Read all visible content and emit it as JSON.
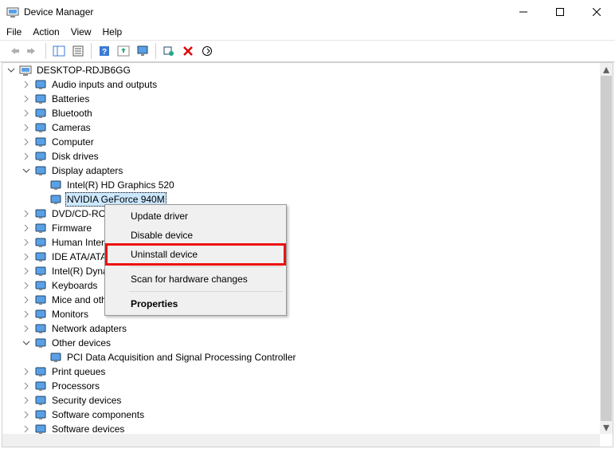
{
  "window": {
    "title": "Device Manager"
  },
  "menus": {
    "file": "File",
    "action": "Action",
    "view": "View",
    "help": "Help"
  },
  "root": "DESKTOP-RDJB6GG",
  "categories": [
    {
      "label": "Audio inputs and outputs"
    },
    {
      "label": "Batteries"
    },
    {
      "label": "Bluetooth"
    },
    {
      "label": "Cameras"
    },
    {
      "label": "Computer"
    },
    {
      "label": "Disk drives"
    },
    {
      "label": "Display adapters",
      "expanded": true,
      "children": [
        {
          "label": "Intel(R) HD Graphics 520"
        },
        {
          "label": "NVIDIA GeForce 940M",
          "selected": true
        }
      ]
    },
    {
      "label": "DVD/CD-ROM"
    },
    {
      "label": "Firmware"
    },
    {
      "label": "Human Interfa"
    },
    {
      "label": "IDE ATA/ATAP"
    },
    {
      "label": "Intel(R) Dynar"
    },
    {
      "label": "Keyboards"
    },
    {
      "label": "Mice and othe"
    },
    {
      "label": "Monitors"
    },
    {
      "label": "Network adapters"
    },
    {
      "label": "Other devices",
      "expanded": true,
      "children": [
        {
          "label": "PCI Data Acquisition and Signal Processing Controller"
        }
      ]
    },
    {
      "label": "Print queues"
    },
    {
      "label": "Processors"
    },
    {
      "label": "Security devices"
    },
    {
      "label": "Software components"
    },
    {
      "label": "Software devices",
      "cut": true
    }
  ],
  "context_menu": {
    "update": "Update driver",
    "disable": "Disable device",
    "uninstall": "Uninstall device",
    "scan": "Scan for hardware changes",
    "properties": "Properties"
  }
}
